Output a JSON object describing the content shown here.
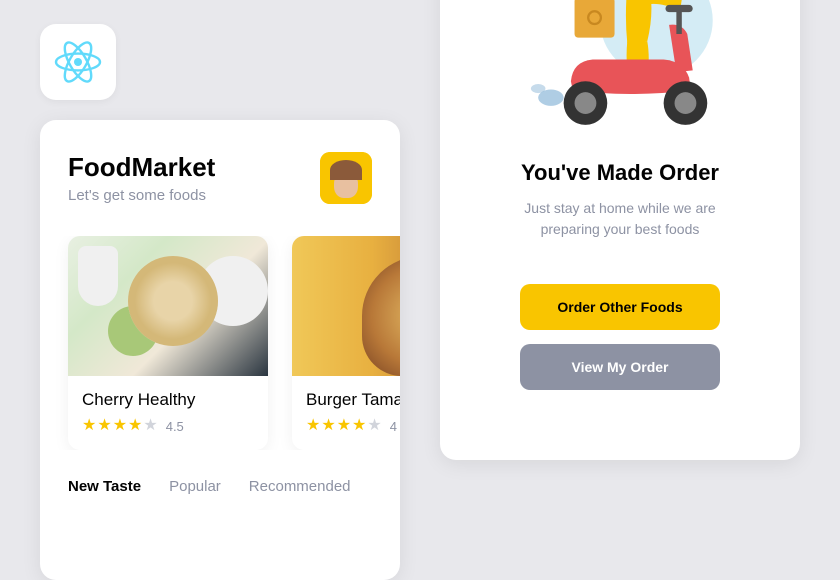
{
  "logo": {
    "name": "react-logo"
  },
  "header": {
    "title": "FoodMarket",
    "subtitle": "Let's get some foods"
  },
  "foods": [
    {
      "name": "Cherry Healthy",
      "rating": 4.5,
      "stars_filled": 4
    },
    {
      "name": "Burger Tamayo",
      "rating": 4,
      "stars_filled": 4
    }
  ],
  "tabs": [
    {
      "label": "New Taste",
      "active": true
    },
    {
      "label": "Popular",
      "active": false
    },
    {
      "label": "Recommended",
      "active": false
    }
  ],
  "order_success": {
    "title": "You've Made Order",
    "subtitle_line1": "Just stay at home while we are",
    "subtitle_line2": "preparing your best foods",
    "primary_btn": "Order Other Foods",
    "secondary_btn": "View My Order"
  },
  "colors": {
    "accent": "#f9c500",
    "text_primary": "#020202",
    "text_muted": "#8d92a3",
    "btn_secondary": "#8d92a3"
  }
}
